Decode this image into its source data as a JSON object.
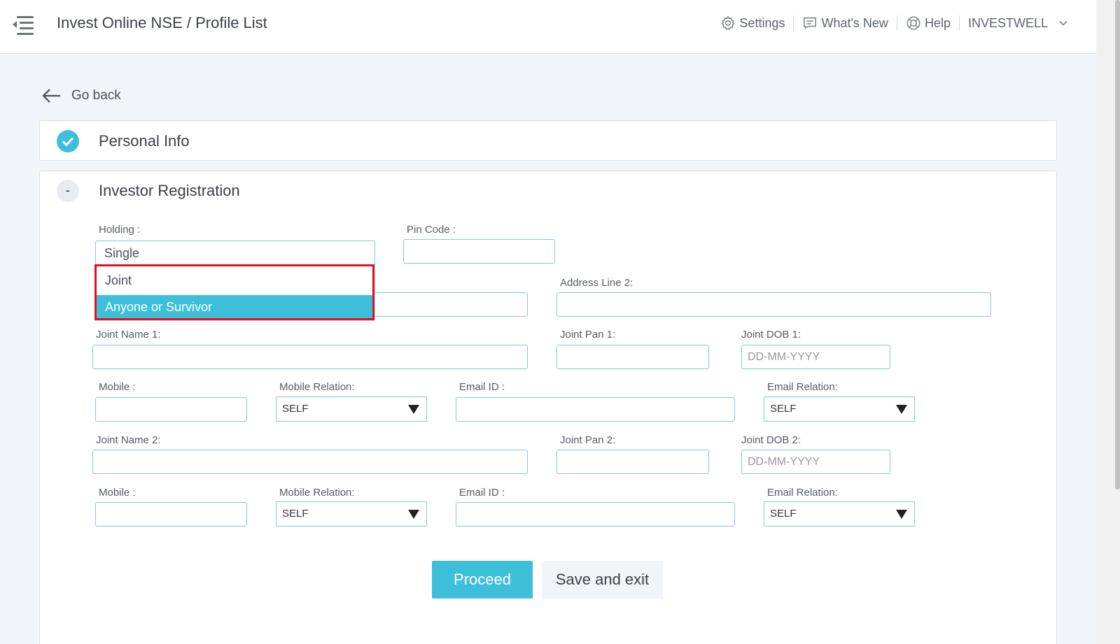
{
  "header": {
    "title": "Invest Online NSE / Profile List",
    "settings": "Settings",
    "whats_new": "What's New",
    "help": "Help",
    "user": "INVESTWELL"
  },
  "go_back": "Go back",
  "sections": {
    "personal_info": "Personal Info",
    "investor_registration": "Investor Registration",
    "collapse_symbol": "-"
  },
  "form": {
    "holding_label": "Holding :",
    "holding_value": "Single",
    "holding_options": [
      "Joint",
      "Anyone or Survivor"
    ],
    "pin_code_label": "Pin Code :",
    "address_line2_label": "Address Line 2:",
    "joint_name1_label": "Joint Name 1:",
    "joint_pan1_label": "Joint Pan 1:",
    "joint_dob1_label": "Joint DOB 1:",
    "dob_placeholder": "DD-MM-YYYY",
    "mobile_label": "Mobile :",
    "mobile_relation_label": "Mobile Relation:",
    "email_label": "Email ID :",
    "email_relation_label": "Email Relation:",
    "relation_value": "SELF",
    "joint_name2_label": "Joint Name 2:",
    "joint_pan2_label": "Joint Pan 2:",
    "joint_dob2_label": "Joint DOB 2:"
  },
  "buttons": {
    "proceed": "Proceed",
    "save_exit": "Save and exit"
  },
  "colors": {
    "accent": "#3dbfd9",
    "highlight": "#e0131f"
  }
}
